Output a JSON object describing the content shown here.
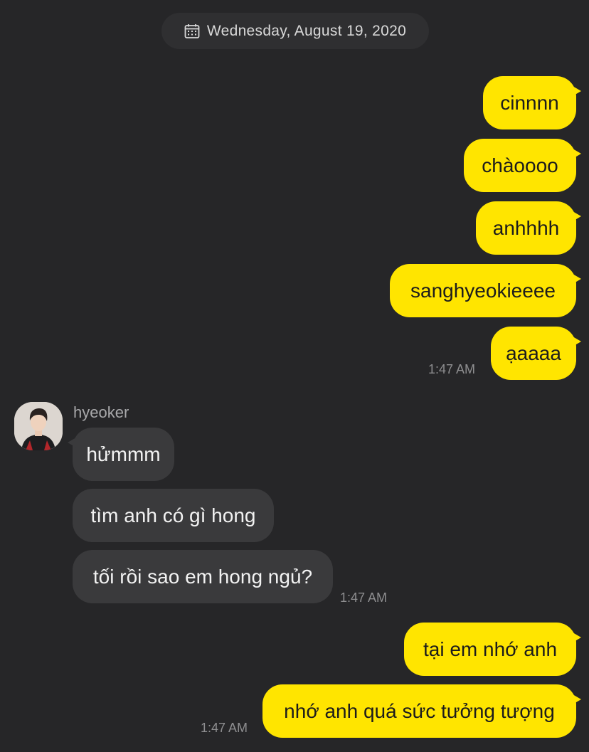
{
  "header": {
    "date": "Wednesday, August 19, 2020",
    "icon": "calendar-icon"
  },
  "colors": {
    "background": "#262628",
    "my_bubble": "#ffe500",
    "their_bubble": "#3a3a3c",
    "timestamp": "#8e8e90"
  },
  "messages": {
    "group1": {
      "m1": "cinnnn",
      "m2": "chàoooo",
      "m3": "anhhhh",
      "m4": "sanghyeokieeee",
      "m5": "ạaaaa",
      "time": "1:47 AM"
    },
    "group2": {
      "sender": "hyeoker",
      "m1": "hửmmm",
      "m2": "tìm anh có gì hong",
      "m3": "tối rồi sao em hong ngủ?",
      "time": "1:47 AM"
    },
    "group3": {
      "m1": "tại em nhớ anh",
      "m2": "nhớ anh quá sức tưởng tượng",
      "time": "1:47 AM"
    }
  }
}
